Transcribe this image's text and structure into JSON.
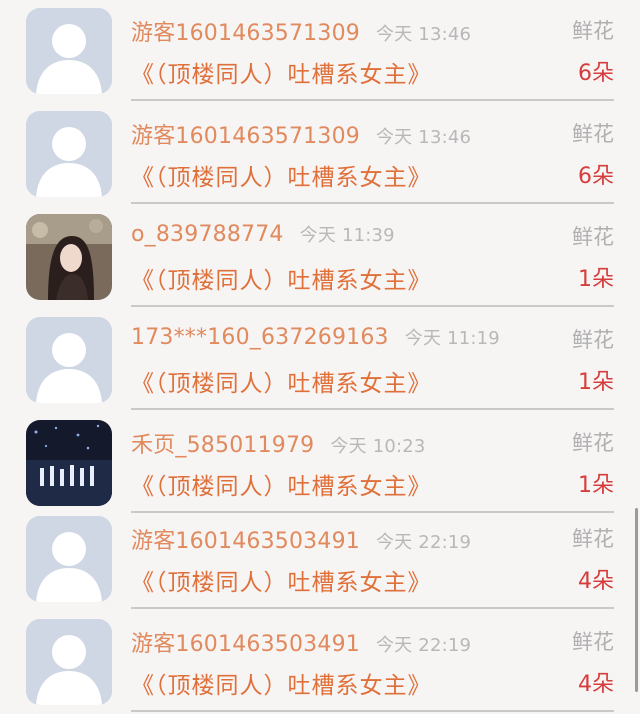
{
  "list": [
    {
      "user": "游客1601463571309",
      "time": "今天 13:46",
      "book": "《（顶楼同人）吐槽系女主》",
      "gift": "鲜花",
      "count": "6朵",
      "avatar": "default"
    },
    {
      "user": "游客1601463571309",
      "time": "今天 13:46",
      "book": "《（顶楼同人）吐槽系女主》",
      "gift": "鲜花",
      "count": "6朵",
      "avatar": "default"
    },
    {
      "user": "o_839788774",
      "time": "今天 11:39",
      "book": "《（顶楼同人）吐槽系女主》",
      "gift": "鲜花",
      "count": "1朵",
      "avatar": "photo-girl"
    },
    {
      "user": "173***160_637269163",
      "time": "今天 11:19",
      "book": "《（顶楼同人）吐槽系女主》",
      "gift": "鲜花",
      "count": "1朵",
      "avatar": "default"
    },
    {
      "user": "禾页_585011979",
      "time": "今天 10:23",
      "book": "《（顶楼同人）吐槽系女主》",
      "gift": "鲜花",
      "count": "1朵",
      "avatar": "photo-stage"
    },
    {
      "user": "游客1601463503491",
      "time": "今天 22:19",
      "book": "《（顶楼同人）吐槽系女主》",
      "gift": "鲜花",
      "count": "4朵",
      "avatar": "default"
    },
    {
      "user": "游客1601463503491",
      "time": "今天 22:19",
      "book": "《（顶楼同人）吐槽系女主》",
      "gift": "鲜花",
      "count": "4朵",
      "avatar": "default"
    }
  ],
  "colors": {
    "name": "#e08a5e",
    "book": "#e0703a",
    "count": "#d63c3c",
    "muted": "#b0b0b0"
  }
}
